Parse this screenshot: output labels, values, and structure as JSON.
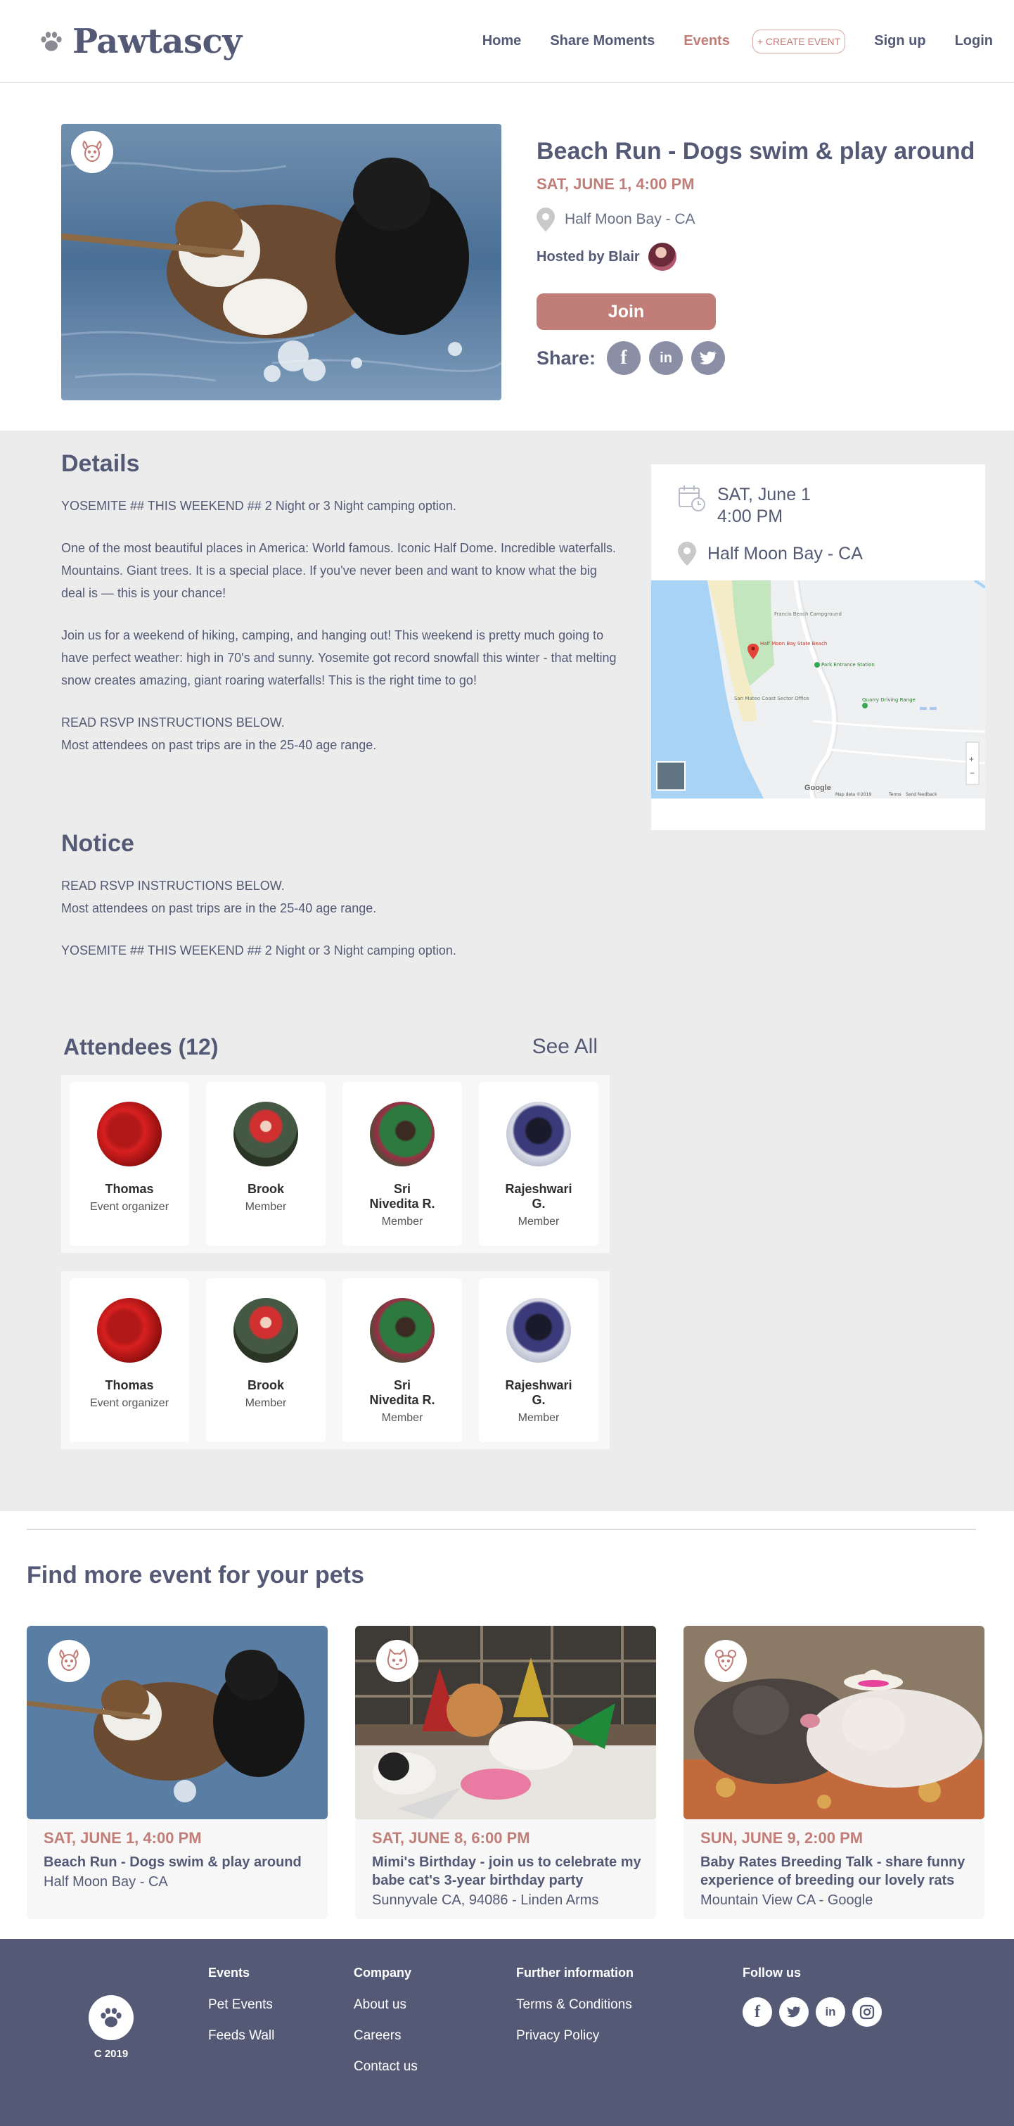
{
  "header": {
    "logo_text": "Pawtascy",
    "nav": {
      "home": "Home",
      "share_moments": "Share Moments",
      "events": "Events",
      "create_event": "+ CREATE EVENT",
      "signup": "Sign up",
      "login": "Login"
    }
  },
  "event": {
    "title": "Beach Run - Dogs swim & play around",
    "when": "SAT, JUNE 1,  4:00 PM",
    "location": "Half Moon Bay - CA",
    "hosted_by": "Hosted by Blair",
    "join_label": "Join",
    "share_label": "Share:"
  },
  "details": {
    "title": "Details",
    "paragraphs": [
      "YOSEMITE ## THIS WEEKEND ## 2 Night or 3 Night camping option.",
      "One of the most beautiful places in America: World famous. Iconic Half Dome. Incredible waterfalls. Mountains. Giant trees. It is a special place. If you've never been and want to know what the big deal is — this is your chance!",
      "Join us for a weekend of hiking, camping, and hanging out! This weekend is pretty much going  to have perfect weather: high in 70's and sunny. Yosemite got record snowfall this winter -  that melting snow creates amazing, giant roaring waterfalls! This is the right time to go!",
      "READ RSVP INSTRUCTIONS BELOW.\nMost attendees on past trips are in the 25-40 age range."
    ]
  },
  "notice": {
    "title": "Notice",
    "paragraphs": [
      "READ RSVP INSTRUCTIONS BELOW.\nMost attendees on past trips are in the 25-40 age range.",
      "YOSEMITE ## THIS WEEKEND ## 2 Night or 3 Night camping option."
    ]
  },
  "side": {
    "date": "SAT, June 1",
    "time": "4:00 PM",
    "location": "Half Moon Bay - CA",
    "map": {
      "labels": [
        "Francis Beach Campground",
        "Half Moon Bay State Beach",
        "Park Entrance Station",
        "San Mateo Coast Sector Office",
        "Quarry Driving Range",
        "Google",
        "Map data ©2019",
        "Terms",
        "Send feedback"
      ]
    }
  },
  "attendees": {
    "title": "Attendees (12)",
    "see_all": "See All",
    "rows": [
      [
        {
          "name": "Thomas",
          "role": "Event organizer"
        },
        {
          "name": "Brook",
          "role": "Member"
        },
        {
          "name": "Sri\nNivedita R.",
          "role": "Member"
        },
        {
          "name": "Rajeshwari\nG.",
          "role": "Member"
        }
      ],
      [
        {
          "name": "Thomas",
          "role": "Event organizer"
        },
        {
          "name": "Brook",
          "role": "Member"
        },
        {
          "name": "Sri\nNivedita R.",
          "role": "Member"
        },
        {
          "name": "Rajeshwari\nG.",
          "role": "Member"
        }
      ]
    ]
  },
  "find_more": {
    "title": "Find more event for your pets",
    "cards": [
      {
        "when": "SAT, JUNE 1,  4:00 PM",
        "name": "Beach Run - Dogs swim & play around",
        "where": "Half Moon Bay - CA",
        "icon": "dog-icon"
      },
      {
        "when": "SAT, JUNE 8,  6:00 PM",
        "name": "Mimi's Birthday - join us to celebrate my babe cat's 3-year birthday party",
        "where": "Sunnyvale  CA, 94086 - Linden Arms",
        "icon": "cat-icon"
      },
      {
        "when": "SUN, JUNE 9,  2:00 PM",
        "name": "Baby Rates Breeding Talk - share funny experience of breeding  our lovely rats",
        "where": " Mountain View  CA - Google",
        "icon": "rat-icon"
      }
    ]
  },
  "footer": {
    "copyright": "C 2019",
    "events": {
      "head": "Events",
      "links": [
        "Pet Events",
        "Feeds Wall"
      ]
    },
    "company": {
      "head": "Company",
      "links": [
        "About us",
        "Careers",
        "Contact us"
      ]
    },
    "further": {
      "head": "Further information",
      "links": [
        "Terms & Conditions",
        "Privacy Policy"
      ]
    },
    "follow": {
      "head": "Follow us"
    }
  },
  "colors": {
    "brand": "#545a75",
    "accent": "#c17d78",
    "band": "#ececec"
  }
}
